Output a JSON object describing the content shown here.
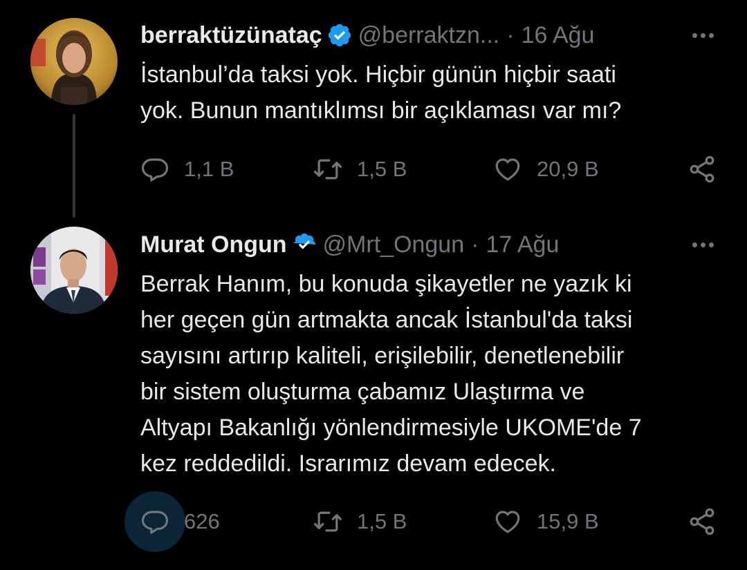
{
  "colors": {
    "background": "#000000",
    "text_primary": "#e7e9ea",
    "text_secondary": "#71767b",
    "verified_blue": "#1d9bf0",
    "thread_line": "#333639"
  },
  "tweets": [
    {
      "display_name": "berraktüzünataç",
      "verified": true,
      "handle": "@berraktzn...",
      "separator": "·",
      "date": "16 Ağu",
      "text_lines": [
        "İstanbul’da taksi yok. Hiçbir günün hiçbir saati",
        "yok. Bunun mantıklımsı bir açıklaması var mı?"
      ],
      "replies": "1,1 B",
      "retweets": "1,5 B",
      "likes": "20,9 B",
      "icons": [
        "reply-icon",
        "retweet-icon",
        "like-icon",
        "share-icon",
        "more-icon"
      ]
    },
    {
      "display_name": "Murat Ongun",
      "verified": true,
      "handle": "@Mrt_Ongun",
      "separator": "·",
      "date": "17 Ağu",
      "text_lines": [
        "Berrak Hanım, bu konuda şikayetler ne yazık ki",
        "her geçen gün artmakta ancak İstanbul'da taksi",
        "sayısını artırıp kaliteli, erişilebilir, denetlenebilir",
        "bir sistem oluşturma çabamız Ulaştırma ve",
        "Altyapı Bakanlığı yönlendirmesiyle UKOME'de 7",
        "kez reddedildi. Israrımız devam edecek."
      ],
      "replies": "626",
      "retweets": "1,5 B",
      "likes": "15,9 B",
      "icons": [
        "reply-icon",
        "retweet-icon",
        "like-icon",
        "share-icon",
        "more-icon"
      ]
    }
  ]
}
